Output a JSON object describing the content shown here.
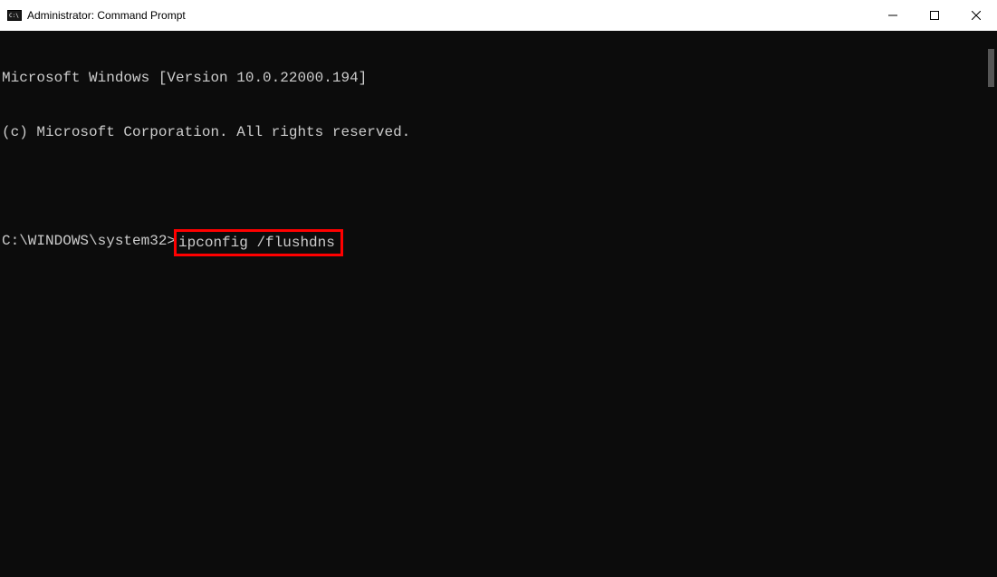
{
  "window": {
    "title": "Administrator: Command Prompt"
  },
  "terminal": {
    "line1": "Microsoft Windows [Version 10.0.22000.194]",
    "line2": "(c) Microsoft Corporation. All rights reserved.",
    "prompt": "C:\\WINDOWS\\system32>",
    "command": "ipconfig /flushdns"
  },
  "highlight": {
    "color": "#ff0000"
  }
}
